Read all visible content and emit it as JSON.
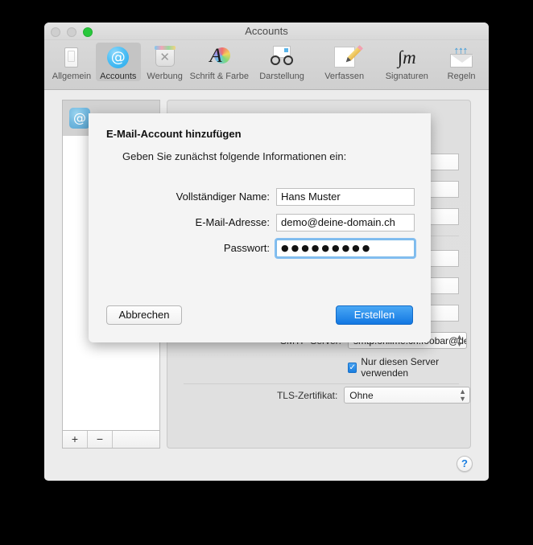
{
  "window": {
    "title": "Accounts",
    "traffic_lights": [
      "close-button",
      "minimize-button",
      "zoom-button"
    ]
  },
  "toolbar": {
    "items": [
      {
        "label": "Allgemein",
        "icon": "general-icon",
        "selected": false
      },
      {
        "label": "Accounts",
        "icon": "at-sign-icon",
        "selected": true
      },
      {
        "label": "Werbung",
        "icon": "junk-trash-icon",
        "selected": false
      },
      {
        "label": "Schrift & Farbe",
        "icon": "font-color-icon",
        "selected": false
      },
      {
        "label": "Darstellung",
        "icon": "viewing-icon",
        "selected": false
      },
      {
        "label": "Verfassen",
        "icon": "compose-icon",
        "selected": false
      },
      {
        "label": "Signaturen",
        "icon": "signature-icon",
        "selected": false
      },
      {
        "label": "Regeln",
        "icon": "rules-icon",
        "selected": false
      }
    ]
  },
  "accounts_list": {
    "rows": [
      {
        "icon": "at-sign-icon",
        "selected": true
      }
    ],
    "footer": {
      "add_label": "+",
      "remove_label": "−"
    }
  },
  "detail": {
    "smtp_row": {
      "label": "SMTP-Server:",
      "value": "smtp.onlime.ch:foobar@deine-"
    },
    "only_this_server": {
      "label": "Nur diesen Server verwenden",
      "checked": true,
      "check_glyph": "✓"
    },
    "tls_row": {
      "label": "TLS-Zertifikat:",
      "value": "Ohne"
    },
    "help_label": "?"
  },
  "sheet": {
    "title": "E-Mail-Account hinzufügen",
    "subtitle": "Geben Sie zunächst folgende Informationen ein:",
    "fields": [
      {
        "label": "Vollständiger Name:",
        "value": "Hans Muster",
        "focused": false
      },
      {
        "label": "E-Mail-Adresse:",
        "value": "demo@deine-domain.ch",
        "focused": false
      },
      {
        "label": "Passwort:",
        "value": "●●●●●●●●●",
        "focused": true
      }
    ],
    "cancel_label": "Abbrechen",
    "create_label": "Erstellen"
  },
  "colors": {
    "accent_blue": "#1277e2",
    "focus_ring": "#7cb9e8",
    "zoom_green": "#28c83c",
    "window_bg": "#ececec",
    "sheet_bg": "#f4f4f4"
  }
}
